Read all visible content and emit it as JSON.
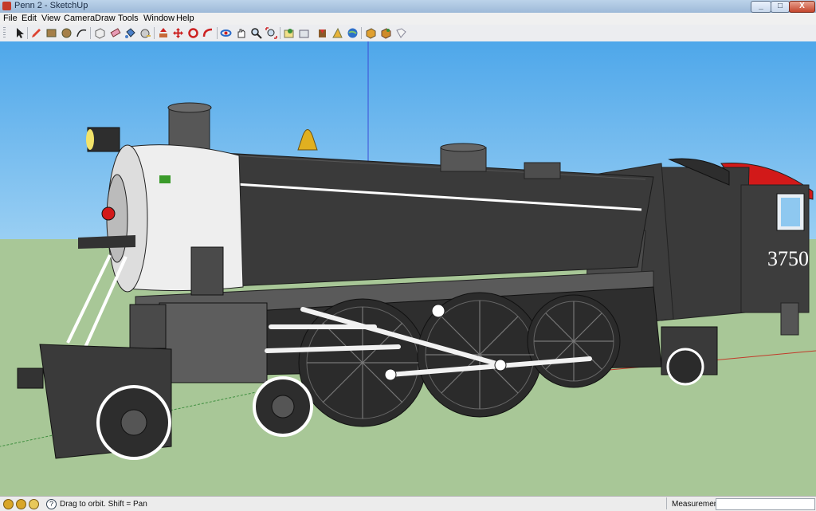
{
  "window": {
    "title": "Penn 2 - SketchUp",
    "controls": {
      "minimize": "_",
      "maximize": "□",
      "close": "X"
    }
  },
  "menubar": {
    "items": [
      "File",
      "Edit",
      "View",
      "Camera",
      "Draw",
      "Tools",
      "Window",
      "Help"
    ]
  },
  "toolbar": {
    "icons": [
      "select-icon",
      "pencil-icon",
      "rectangle-icon",
      "circle-icon",
      "arc-icon",
      "make-component-icon",
      "eraser-icon",
      "paint-bucket-icon",
      "tape-measure-icon",
      "push-pull-icon",
      "move-icon",
      "rotate-icon",
      "follow-me-icon",
      "orbit-icon",
      "pan-icon",
      "zoom-icon",
      "zoom-extents-icon",
      "add-location-icon",
      "toggle-terrain-icon",
      "get-models-icon",
      "share-model-icon",
      "google-earth-icon",
      "get-models-3d-icon",
      "share-component-icon",
      "send-to-layout-icon"
    ]
  },
  "model": {
    "locomotive_number": "3750",
    "colors": {
      "sky": "#62b3ed",
      "ground": "#a9c898",
      "body": "#3a3a3a",
      "smokebox": "#eeeeee",
      "cab_roof": "#d21919",
      "bell": "#e0b020"
    }
  },
  "statusbar": {
    "hint": "Drag to orbit.  Shift = Pan",
    "measurements_label": "Measurements",
    "measurements_value": ""
  }
}
